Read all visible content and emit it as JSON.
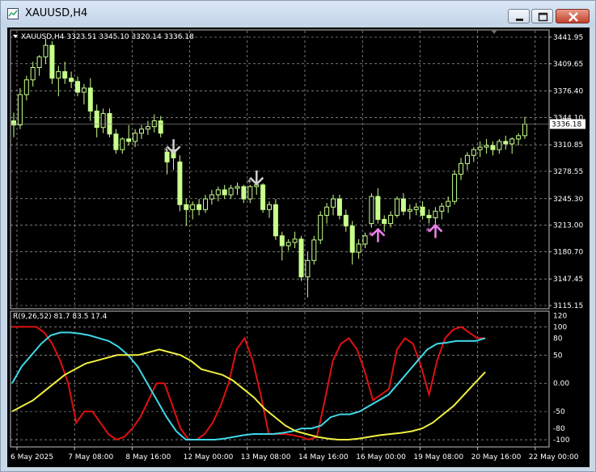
{
  "window": {
    "title": "XAUUSD,H4",
    "buttons": {
      "minimize": "minimize",
      "maximize": "maximize",
      "close": "close"
    }
  },
  "colors": {
    "background": "#000000",
    "bull_candle": "#c8ff8c",
    "grid": "#c0c0c0",
    "line_red": "#e01010",
    "line_cyan": "#40d8e8",
    "line_yellow": "#f0f040",
    "sell_arrow": "#d0d0d0",
    "buy_arrow": "#ee82ee"
  },
  "price_panel": {
    "header": "XAUUSD,H4  3323.51 3345.10 3320.14 3336.18",
    "current_price": "3336.18",
    "axis_ticks": [
      "3441.95",
      "3409.65",
      "3376.40",
      "3344.10",
      "3310.85",
      "3278.55",
      "3245.30",
      "3213.00",
      "3180.70",
      "3147.45",
      "3115.15"
    ]
  },
  "indicator_panel": {
    "header": "R(9,26,52) 81.7 83.5 17.4",
    "axis_ticks": [
      "120",
      "100",
      "80",
      "50",
      "0.00",
      "-50",
      "-80",
      "-100"
    ]
  },
  "time_axis": [
    "6 May 2025",
    "7 May 08:00",
    "8 May 16:00",
    "12 May 00:00",
    "13 May 08:00",
    "14 May 16:00",
    "16 May 00:00",
    "19 May 08:00",
    "20 May 16:00",
    "22 May 00:00"
  ],
  "chart_data": {
    "type": "candlestick",
    "symbol": "XAUUSD",
    "timeframe": "H4",
    "ylim": [
      3115.15,
      3441.95
    ],
    "candles": [
      [
        3340,
        3350,
        3320,
        3335
      ],
      [
        3335,
        3380,
        3330,
        3372
      ],
      [
        3372,
        3395,
        3365,
        3390
      ],
      [
        3390,
        3412,
        3382,
        3405
      ],
      [
        3405,
        3420,
        3395,
        3418
      ],
      [
        3418,
        3440,
        3410,
        3432
      ],
      [
        3432,
        3437,
        3385,
        3392
      ],
      [
        3392,
        3407,
        3370,
        3400
      ],
      [
        3400,
        3412,
        3385,
        3392
      ],
      [
        3392,
        3400,
        3380,
        3388
      ],
      [
        3388,
        3394,
        3370,
        3375
      ],
      [
        3375,
        3385,
        3360,
        3380
      ],
      [
        3380,
        3392,
        3340,
        3352
      ],
      [
        3352,
        3360,
        3320,
        3332
      ],
      [
        3332,
        3355,
        3325,
        3349
      ],
      [
        3349,
        3355,
        3320,
        3324
      ],
      [
        3324,
        3330,
        3300,
        3305
      ],
      [
        3305,
        3320,
        3300,
        3318
      ],
      [
        3318,
        3335,
        3310,
        3315
      ],
      [
        3315,
        3330,
        3308,
        3325
      ],
      [
        3325,
        3335,
        3318,
        3330
      ],
      [
        3330,
        3340,
        3323,
        3333
      ],
      [
        3333,
        3348,
        3326,
        3340
      ],
      [
        3340,
        3346,
        3320,
        3325
      ],
      [
        3302,
        3305,
        3275,
        3290
      ],
      [
        3305,
        3308,
        3280,
        3295
      ],
      [
        3290,
        3298,
        3230,
        3238
      ],
      [
        3238,
        3245,
        3212,
        3232
      ],
      [
        3232,
        3242,
        3220,
        3238
      ],
      [
        3238,
        3245,
        3225,
        3232
      ],
      [
        3232,
        3250,
        3228,
        3245
      ],
      [
        3245,
        3256,
        3238,
        3250
      ],
      [
        3250,
        3260,
        3242,
        3256
      ],
      [
        3256,
        3262,
        3245,
        3250
      ],
      [
        3250,
        3262,
        3245,
        3258
      ],
      [
        3258,
        3265,
        3250,
        3260
      ],
      [
        3260,
        3262,
        3240,
        3245
      ],
      [
        3245,
        3262,
        3240,
        3260
      ],
      [
        3260,
        3268,
        3250,
        3262
      ],
      [
        3262,
        3264,
        3228,
        3232
      ],
      [
        3232,
        3242,
        3222,
        3238
      ],
      [
        3238,
        3245,
        3195,
        3200
      ],
      [
        3200,
        3205,
        3170,
        3188
      ],
      [
        3188,
        3196,
        3182,
        3192
      ],
      [
        3192,
        3205,
        3185,
        3196
      ],
      [
        3196,
        3200,
        3145,
        3150
      ],
      [
        3150,
        3180,
        3125,
        3170
      ],
      [
        3170,
        3200,
        3165,
        3195
      ],
      [
        3195,
        3230,
        3190,
        3225
      ],
      [
        3225,
        3240,
        3215,
        3235
      ],
      [
        3235,
        3250,
        3225,
        3245
      ],
      [
        3245,
        3250,
        3220,
        3225
      ],
      [
        3225,
        3232,
        3205,
        3212
      ],
      [
        3212,
        3218,
        3165,
        3180
      ],
      [
        3180,
        3196,
        3172,
        3190
      ],
      [
        3190,
        3204,
        3185,
        3200
      ],
      [
        3215,
        3252,
        3210,
        3248
      ],
      [
        3248,
        3258,
        3215,
        3220
      ],
      [
        3220,
        3225,
        3205,
        3215
      ],
      [
        3215,
        3230,
        3210,
        3225
      ],
      [
        3225,
        3248,
        3222,
        3245
      ],
      [
        3245,
        3252,
        3225,
        3230
      ],
      [
        3230,
        3238,
        3220,
        3232
      ],
      [
        3232,
        3240,
        3225,
        3235
      ],
      [
        3235,
        3242,
        3220,
        3225
      ],
      [
        3225,
        3232,
        3215,
        3222
      ],
      [
        3222,
        3235,
        3210,
        3230
      ],
      [
        3230,
        3240,
        3220,
        3236
      ],
      [
        3236,
        3248,
        3228,
        3242
      ],
      [
        3242,
        3280,
        3238,
        3275
      ],
      [
        3275,
        3295,
        3268,
        3288
      ],
      [
        3288,
        3302,
        3280,
        3298
      ],
      [
        3298,
        3308,
        3290,
        3305
      ],
      [
        3305,
        3315,
        3296,
        3308
      ],
      [
        3308,
        3318,
        3300,
        3310
      ],
      [
        3310,
        3315,
        3298,
        3305
      ],
      [
        3305,
        3318,
        3300,
        3315
      ],
      [
        3315,
        3322,
        3305,
        3312
      ],
      [
        3312,
        3320,
        3300,
        3318
      ],
      [
        3318,
        3325,
        3310,
        3322
      ],
      [
        3322,
        3345,
        3318,
        3336
      ]
    ],
    "signals": [
      {
        "type": "sell",
        "index": 24,
        "price": 3300
      },
      {
        "type": "sell",
        "index": 37,
        "price": 3262
      },
      {
        "type": "buy",
        "index": 56,
        "price": 3210
      },
      {
        "type": "buy",
        "index": 65,
        "price": 3215
      }
    ],
    "indicator": {
      "name": "R(9,26,52)",
      "ylim": [
        -110,
        125
      ],
      "series": [
        {
          "color": "#e01010",
          "values": [
            100,
            100,
            100,
            100,
            90,
            70,
            40,
            0,
            -70,
            -50,
            -50,
            -70,
            -90,
            -100,
            -95,
            -80,
            -60,
            -30,
            0,
            0,
            -40,
            -80,
            -100,
            -100,
            -90,
            -70,
            -40,
            0,
            60,
            80,
            40,
            -20,
            -90,
            -90,
            -90,
            -92,
            -95,
            -100,
            -95,
            -30,
            40,
            70,
            80,
            60,
            20,
            -30,
            -20,
            -10,
            60,
            80,
            70,
            30,
            -20,
            40,
            80,
            95,
            100,
            90,
            80,
            80
          ]
        },
        {
          "color": "#40d8e8",
          "values": [
            0,
            30,
            50,
            70,
            85,
            90,
            90,
            88,
            85,
            80,
            75,
            65,
            50,
            30,
            0,
            -30,
            -60,
            -85,
            -100,
            -100,
            -100,
            -100,
            -98,
            -95,
            -92,
            -90,
            -90,
            -90,
            -88,
            -85,
            -80,
            -80,
            -75,
            -60,
            -55,
            -55,
            -50,
            -40,
            -30,
            -20,
            0,
            20,
            40,
            60,
            70,
            72,
            75,
            75,
            75,
            80
          ]
        },
        {
          "color": "#f0f040",
          "values": [
            -50,
            -40,
            -30,
            -15,
            0,
            15,
            25,
            35,
            40,
            45,
            50,
            50,
            50,
            55,
            60,
            55,
            50,
            40,
            25,
            20,
            15,
            5,
            -10,
            -25,
            -45,
            -60,
            -75,
            -85,
            -90,
            -95,
            -98,
            -100,
            -100,
            -98,
            -95,
            -92,
            -90,
            -88,
            -85,
            -80,
            -70,
            -55,
            -40,
            -20,
            0,
            20
          ]
        }
      ]
    }
  }
}
